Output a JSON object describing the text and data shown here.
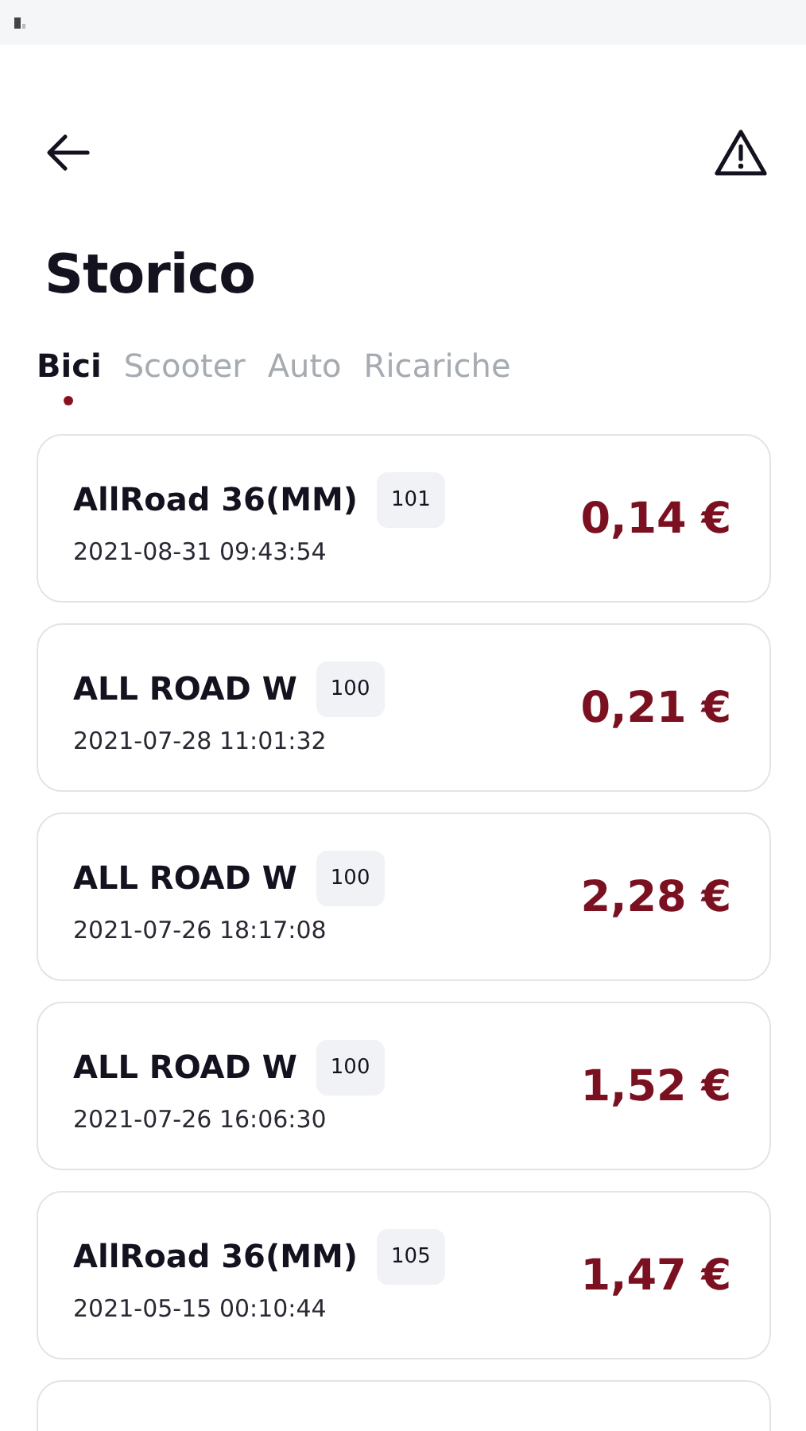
{
  "header": {
    "title": "Storico"
  },
  "tabs": [
    {
      "label": "Bici",
      "selected": true
    },
    {
      "label": "Scooter",
      "selected": false
    },
    {
      "label": "Auto",
      "selected": false
    },
    {
      "label": "Ricariche",
      "selected": false
    }
  ],
  "rides": [
    {
      "name": "AllRoad 36(MM)",
      "badge": "101",
      "date": "2021-08-31 09:43:54",
      "price": "0,14 €"
    },
    {
      "name": "ALL ROAD W",
      "badge": "100",
      "date": "2021-07-28 11:01:32",
      "price": "0,21 €"
    },
    {
      "name": "ALL ROAD W",
      "badge": "100",
      "date": "2021-07-26 18:17:08",
      "price": "2,28 €"
    },
    {
      "name": "ALL ROAD W",
      "badge": "100",
      "date": "2021-07-26 16:06:30",
      "price": "1,52 €"
    },
    {
      "name": "AllRoad 36(MM)",
      "badge": "105",
      "date": "2021-05-15 00:10:44",
      "price": "1,47 €"
    }
  ]
}
